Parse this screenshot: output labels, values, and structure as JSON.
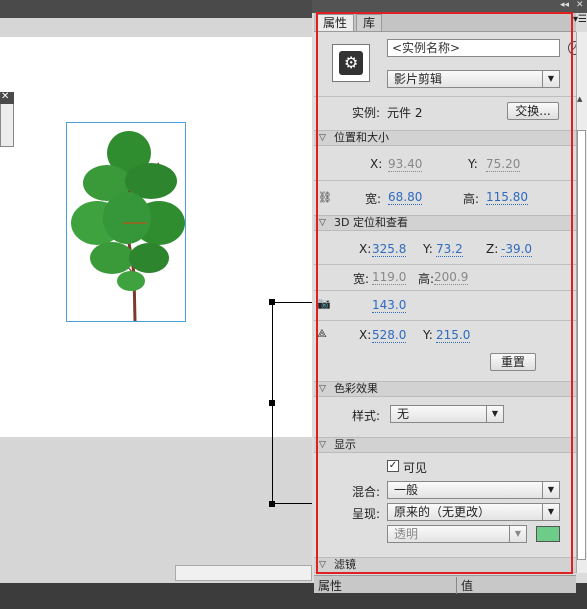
{
  "colors": {
    "accent": "#2e6bbf",
    "highlight": "#e02020",
    "swatch": "#6ccc88"
  },
  "panel": {
    "tabs": [
      "属性",
      "库"
    ],
    "instance_name_placeholder": "<实例名称>",
    "type_select": "影片剪辑",
    "instance_label": "实例:",
    "instance_of": "元件 2",
    "swap_button": "交换..."
  },
  "position_size": {
    "title": "位置和大小",
    "x_label": "X:",
    "x_value": "93.40",
    "y_label": "Y:",
    "y_value": "75.20",
    "width_label": "宽:",
    "width_value": "68.80",
    "height_label": "高:",
    "height_value": "115.80",
    "link_icon": "chain-link-icon"
  },
  "position_3d": {
    "title": "3D 定位和查看",
    "x_label": "X:",
    "x_value": "325.8",
    "y_label": "Y:",
    "y_value": "73.2",
    "z_label": "Z:",
    "z_value": "-39.0",
    "width_label": "宽:",
    "width_value": "119.0",
    "height_label": "高:",
    "height_value": "200.9",
    "perspective_icon": "camera-icon",
    "perspective_value": "143.0",
    "vanish_icon": "vanishing-point-icon",
    "vx_label": "X:",
    "vx_value": "528.0",
    "vy_label": "Y:",
    "vy_value": "215.0",
    "reset_button": "重置"
  },
  "color_effect": {
    "title": "色彩效果",
    "style_label": "样式:",
    "style_value": "无"
  },
  "display": {
    "title": "显示",
    "visible_label": "可见",
    "visible_checked": "✓",
    "blend_label": "混合:",
    "blend_value": "一般",
    "render_label": "呈现:",
    "render_value": "原来的（无更改）",
    "transparent_value": "透明"
  },
  "filters": {
    "title": "滤镜"
  },
  "footer": {
    "col1": "属性",
    "col2": "值"
  }
}
